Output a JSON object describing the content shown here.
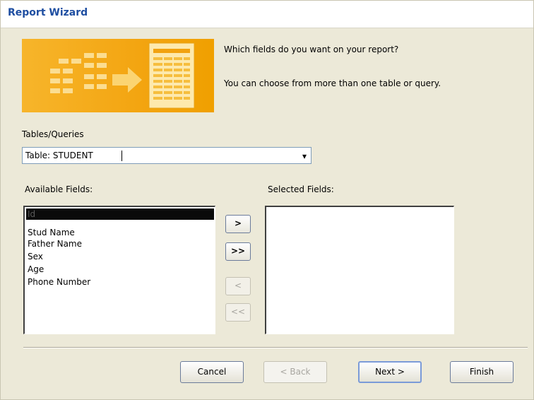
{
  "window": {
    "title": "Report Wizard"
  },
  "header": {
    "prompt_line1": "Which fields do you want on your report?",
    "prompt_line2": "You can choose from more than one table or query."
  },
  "source": {
    "label": "Tables/Queries",
    "selected_value": "Table: STUDENT"
  },
  "available_fields": {
    "label": "Available Fields:",
    "items": [
      "Id",
      "Stud Name",
      "Father Name",
      "Sex",
      "Age",
      "Phone Number"
    ],
    "selected_item": "Id"
  },
  "selected_fields": {
    "label": "Selected Fields:",
    "items": []
  },
  "move_buttons": {
    "add_one": ">",
    "add_all": ">>",
    "remove_one": "<",
    "remove_all": "<<"
  },
  "footer": {
    "cancel": "Cancel",
    "back": "< Back",
    "next": "Next >",
    "finish": "Finish"
  },
  "colors": {
    "title": "#1e4ea1",
    "banner": "#f3a511",
    "dialog_bg": "#ece9d8",
    "selection_bg": "#0a0a0a"
  }
}
